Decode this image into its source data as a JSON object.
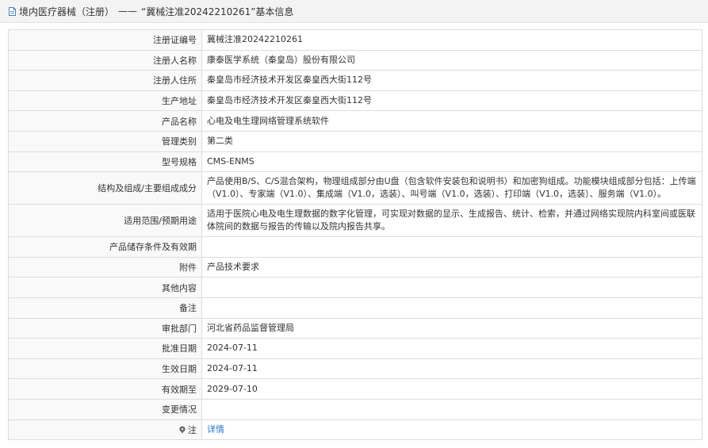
{
  "header": {
    "icon": "document-icon",
    "category": "境内医疗器械（注册）",
    "separator": "——",
    "title": "“冀械注准20242210261”基本信息"
  },
  "rows": [
    {
      "label": "注册证编号",
      "value": "冀械注准20242210261"
    },
    {
      "label": "注册人名称",
      "value": "康泰医学系统（秦皇岛）股份有限公司"
    },
    {
      "label": "注册人住所",
      "value": "秦皇岛市经济技术开发区秦皇西大街112号"
    },
    {
      "label": "生产地址",
      "value": "秦皇岛市经济技术开发区秦皇西大街112号"
    },
    {
      "label": "产品名称",
      "value": "心电及电生理网络管理系统软件"
    },
    {
      "label": "管理类别",
      "value": "第二类"
    },
    {
      "label": "型号规格",
      "value": "CMS-ENMS"
    },
    {
      "label": "结构及组成/主要组成成分",
      "value": "产品使用B/S、C/S混合架构，物理组成部分由U盘（包含软件安装包和说明书）和加密狗组成。功能模块组成部分包括：上传端（V1.0）、专家端（V1.0）、集成端（V1.0，选装）、叫号端（V1.0，选装）、打印端（V1.0，选装）、服务端（V1.0）。"
    },
    {
      "label": "适用范围/预期用途",
      "value": "适用于医院心电及电生理数据的数字化管理，可实现对数据的显示、生成报告、统计、检索，并通过网络实现院内科室间或医联体院间的数据与报告的传输以及院内报告共享。"
    },
    {
      "label": "产品储存条件及有效期",
      "value": ""
    },
    {
      "label": "附件",
      "value": "产品技术要求"
    },
    {
      "label": "其他内容",
      "value": ""
    },
    {
      "label": "备注",
      "value": ""
    },
    {
      "label": "审批部门",
      "value": "河北省药品监督管理局"
    },
    {
      "label": "批准日期",
      "value": "2024-07-11"
    },
    {
      "label": "生效日期",
      "value": "2024-07-11"
    },
    {
      "label": "有效期至",
      "value": "2029-07-10"
    },
    {
      "label": "变更情况",
      "value": ""
    }
  ],
  "note": {
    "icon": "info-pin-icon",
    "label": "注",
    "link_text": "详情"
  },
  "colors": {
    "header_bg": "#f3f3f3",
    "label_bg": "#f9f9f9",
    "border": "#dddddd",
    "link": "#2c73c6"
  }
}
